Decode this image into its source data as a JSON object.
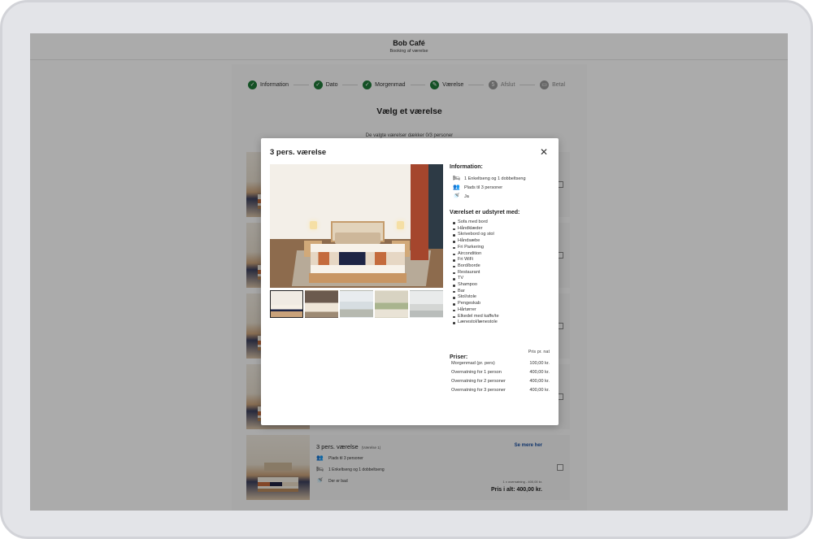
{
  "app": {
    "title": "Bob Café",
    "subtitle": "Booking af værelse"
  },
  "steps": [
    {
      "label": "Information",
      "state": "done"
    },
    {
      "label": "Dato",
      "state": "done"
    },
    {
      "label": "Morgenmad",
      "state": "done"
    },
    {
      "label": "Værelse",
      "state": "current"
    },
    {
      "label": "Afslut",
      "state": "pending",
      "number": "5"
    },
    {
      "label": "Betal",
      "state": "pending"
    }
  ],
  "page": {
    "heading": "Vælg et værelse",
    "selection_note": "De valgte værelser dækker 0/3 personer"
  },
  "room_card": {
    "title": "3 pers. værelse",
    "subtitle": "(Værelse 1)",
    "more_link": "Se mere her",
    "features": [
      "Plads til 3 personer",
      "1 Enkeltseng og 1 dobbeltseng",
      "Der er bad"
    ],
    "price_sub": "1 x overnatning - 400,00 kr.",
    "price_total": "Pris i alt: 400,00 kr."
  },
  "modal": {
    "title": "3 pers. værelse",
    "close_icon": "close-icon",
    "information": {
      "heading": "Information:",
      "items": [
        {
          "icon": "bed-icon",
          "text": "1 Enkeltseng og 1 dobbeltseng"
        },
        {
          "icon": "people-icon",
          "text": "Plads til 3 personer"
        },
        {
          "icon": "shower-icon",
          "text": "Ja"
        }
      ]
    },
    "amenities": {
      "heading": "Værelset er udstyret med:",
      "items": [
        "Sofa med bord",
        "Håndklæder",
        "Skrivebord og stol",
        "Håndsæbe",
        "Fri Parkering",
        "Aircondition",
        "Fri WiFi",
        "Bord/borde",
        "Restaurant",
        "TV",
        "Shampoo",
        "Bar",
        "Stol/stole",
        "Pengeskab",
        "Hårtørrer",
        "Elkedel med kaffe/te",
        "Lænestol/lænestole"
      ]
    },
    "prices": {
      "heading": "Priser:",
      "per_night": "Pris pr. nat",
      "rows": [
        {
          "label": "Morgenmad (pr. pers)",
          "value": "100,00 kr."
        },
        {
          "label": "Overnatning for 1 person",
          "value": "400,00 kr."
        },
        {
          "label": "Overnatning for 2 personer",
          "value": "400,00 kr."
        },
        {
          "label": "Overnatning for 3 personer",
          "value": "400,00 kr."
        }
      ]
    },
    "thumbnails": 5
  },
  "colors": {
    "step_done": "#1f7a38",
    "step_pending": "#9a9a9a",
    "link": "#1a4fa0",
    "overlay": "rgba(0,0,0,0.33)"
  }
}
